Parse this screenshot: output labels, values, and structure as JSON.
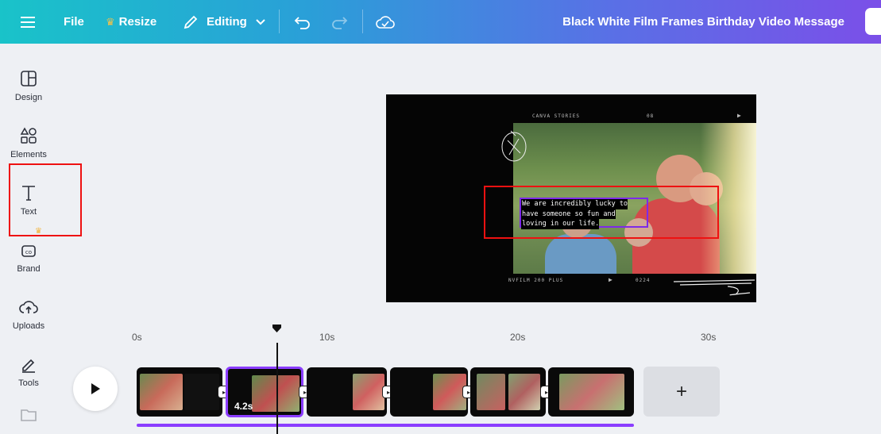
{
  "topbar": {
    "file_label": "File",
    "resize_label": "Resize",
    "editing_label": "Editing",
    "title": "Black White Film Frames Birthday Video Message"
  },
  "sidebar": {
    "items": [
      {
        "label": "Design",
        "icon": "design-icon"
      },
      {
        "label": "Elements",
        "icon": "elements-icon"
      },
      {
        "label": "Text",
        "icon": "text-icon"
      },
      {
        "label": "Brand",
        "icon": "brand-icon"
      },
      {
        "label": "Uploads",
        "icon": "uploads-icon"
      },
      {
        "label": "Tools",
        "icon": "tools-icon"
      }
    ]
  },
  "canvas": {
    "film_top_left": "CANVA STORIES",
    "film_top_mid": "08",
    "film_bottom_left": "NVFILM 200 PLUS",
    "film_bottom_mid": "0224",
    "text_lines": [
      "We are incredibly lucky to",
      "have someone so fun and",
      "loving in our life."
    ]
  },
  "timeline": {
    "ticks": [
      "0s",
      "10s",
      "20s",
      "30s"
    ],
    "selected_duration": "4.2s",
    "clips": [
      "clip-1",
      "clip-2",
      "clip-3",
      "clip-4",
      "clip-5",
      "clip-6"
    ],
    "add_label": "+"
  },
  "colors": {
    "accent": "#8b3dff",
    "annotation": "#ee1111",
    "crown": "#f2b33a"
  }
}
